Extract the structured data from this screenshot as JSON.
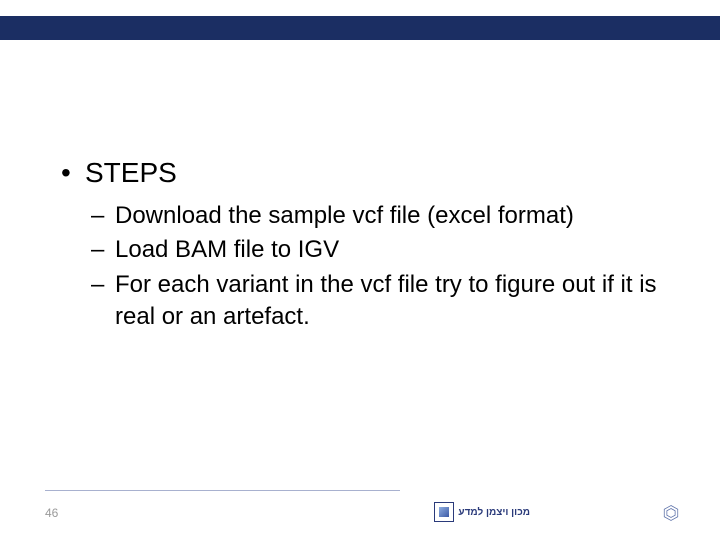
{
  "heading": "STEPS",
  "sub_items": [
    "Download the sample vcf file (excel format)",
    "Load BAM file to IGV",
    "For each variant in the vcf file try to figure out if it is real or an artefact."
  ],
  "page_number": "46",
  "footer_logo_text": "מכון ויצמן למדע",
  "footer_right_text": ""
}
